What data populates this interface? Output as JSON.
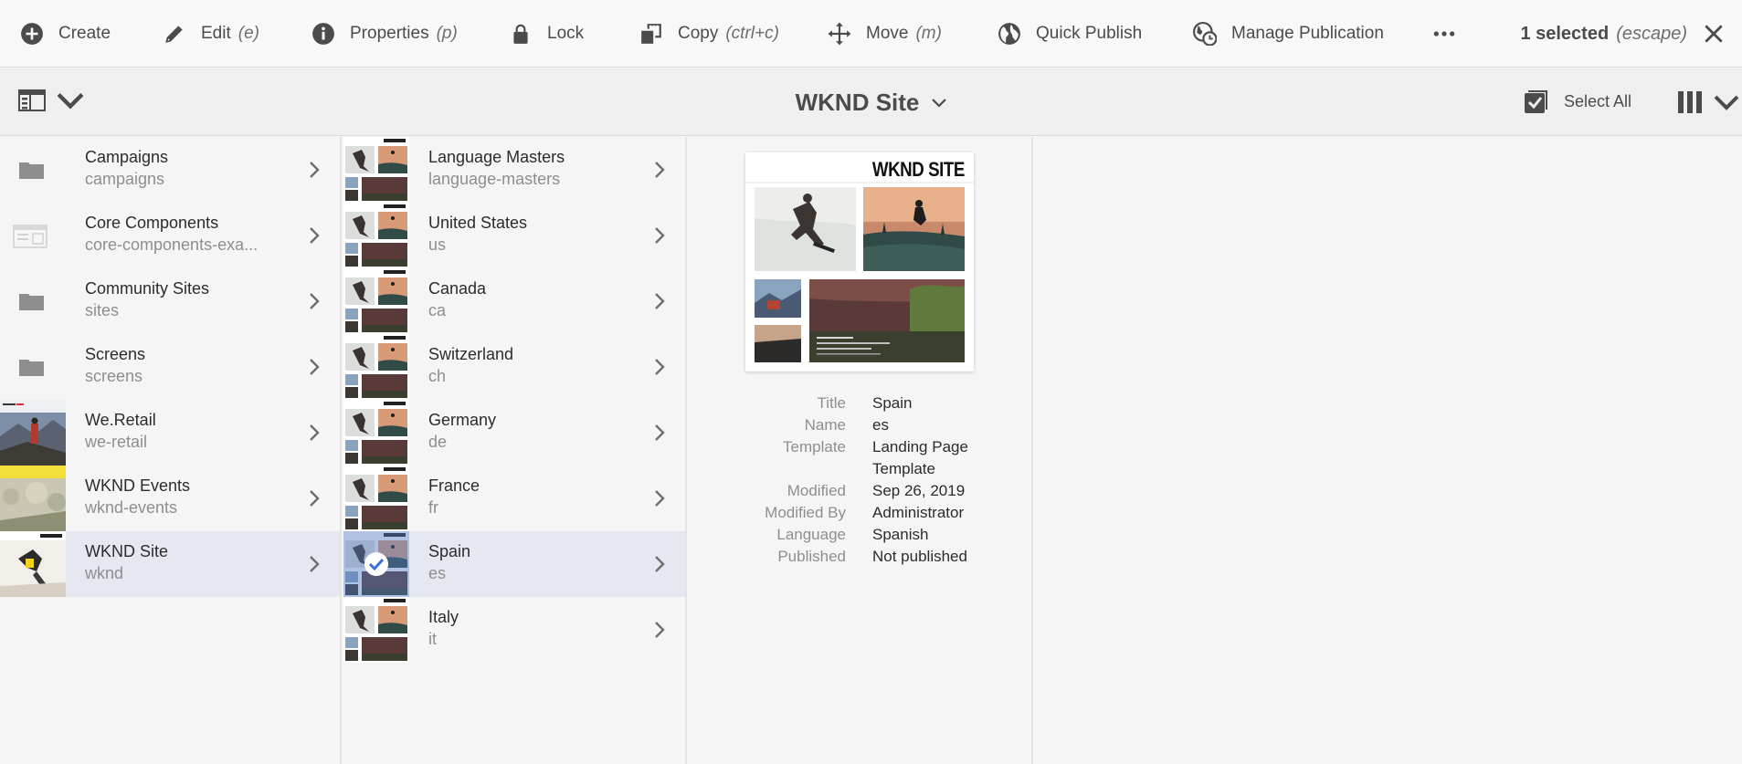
{
  "actionbar": {
    "create": "Create",
    "edit": "Edit",
    "edit_key": "(e)",
    "properties": "Properties",
    "properties_key": "(p)",
    "lock": "Lock",
    "copy": "Copy",
    "copy_key": "(ctrl+c)",
    "move": "Move",
    "move_key": "(m)",
    "quick_publish": "Quick Publish",
    "manage_publication": "Manage Publication",
    "selected_count": "1 selected",
    "selected_key": "(escape)"
  },
  "header": {
    "title": "WKND Site",
    "select_all": "Select All"
  },
  "column1": [
    {
      "title": "Campaigns",
      "name": "campaigns",
      "thumb": "folder"
    },
    {
      "title": "Core Components",
      "name": "core-components-exa...",
      "thumb": "components"
    },
    {
      "title": "Community Sites",
      "name": "sites",
      "thumb": "folder"
    },
    {
      "title": "Screens",
      "name": "screens",
      "thumb": "folder"
    },
    {
      "title": "We.Retail",
      "name": "we-retail",
      "thumb": "we-retail"
    },
    {
      "title": "WKND Events",
      "name": "wknd-events",
      "thumb": "wknd-events"
    },
    {
      "title": "WKND Site",
      "name": "wknd",
      "thumb": "wknd"
    }
  ],
  "column2": [
    {
      "title": "Language Masters",
      "name": "language-masters"
    },
    {
      "title": "United States",
      "name": "us"
    },
    {
      "title": "Canada",
      "name": "ca"
    },
    {
      "title": "Switzerland",
      "name": "ch"
    },
    {
      "title": "Germany",
      "name": "de"
    },
    {
      "title": "France",
      "name": "fr"
    },
    {
      "title": "Spain",
      "name": "es"
    },
    {
      "title": "Italy",
      "name": "it"
    }
  ],
  "preview": {
    "logo": "WKND SITE"
  },
  "properties": [
    {
      "label": "Title",
      "value": "Spain"
    },
    {
      "label": "Name",
      "value": "es"
    },
    {
      "label": "Template",
      "value": "Landing Page"
    },
    {
      "label": "",
      "value": "Template"
    },
    {
      "label": "Modified",
      "value": "Sep 26, 2019"
    },
    {
      "label": "Modified By",
      "value": "Administrator"
    },
    {
      "label": "Language",
      "value": "Spanish"
    },
    {
      "label": "Published",
      "value": "Not published"
    }
  ],
  "colors": {
    "active_row": "#e5e8f1",
    "text": "#2c2c2c",
    "muted": "#8e8e8e",
    "icon": "#4b4b4b"
  }
}
